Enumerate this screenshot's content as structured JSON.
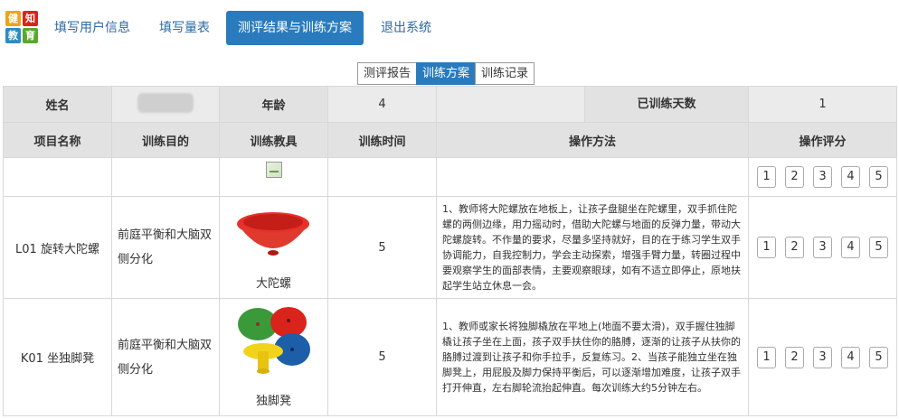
{
  "logo": {
    "chars": [
      "健",
      "知",
      "教",
      "育"
    ]
  },
  "nav": {
    "items": [
      {
        "label": "填写用户信息"
      },
      {
        "label": "填写量表"
      },
      {
        "label": "测评结果与训练方案"
      },
      {
        "label": "退出系统"
      }
    ],
    "active_index": 2
  },
  "subtabs": {
    "items": [
      {
        "label": "测评报告"
      },
      {
        "label": "训练方案"
      },
      {
        "label": "训练记录"
      }
    ],
    "active_index": 1
  },
  "info": {
    "name_label": "姓名",
    "name_value": "",
    "age_label": "年龄",
    "age_value": "4",
    "days_label": "已训练天数",
    "days_value": "1"
  },
  "headers": [
    "项目名称",
    "训练目的",
    "训练教具",
    "训练时间",
    "操作方法",
    "操作评分"
  ],
  "rating_labels": [
    "1",
    "2",
    "3",
    "4",
    "5"
  ],
  "rows": [
    {
      "name": "L01 旋转大陀螺",
      "purpose": "前庭平衡和大脑双侧分化",
      "tool": "大陀螺",
      "time": "5",
      "method": "1、教师将大陀螺放在地板上，让孩子盘腿坐在陀螺里，双手抓住陀螺的两侧边缘，用力摇动时，借助大陀螺与地面的反弹力量，带动大陀螺旋转。不作量的要求，尽量多坚持就好，目的在于练习学生双手协调能力，自我控制力，学会主动探索，增强手臂力量，转圈过程中要观察学生的面部表情，主要观察眼球，如有不适立即停止，原地扶起学生站立休息一会。"
    },
    {
      "name": "K01 坐独脚凳",
      "purpose": "前庭平衡和大脑双侧分化",
      "tool": "独脚凳",
      "time": "5",
      "method": "1、教师或家长将独脚橇放在平地上(地面不要太滑)，双手握住独脚橇让孩子坐在上面，孩子双手扶住你的胳膊，逐渐的让孩子从扶你的胳膊过渡到让孩子和你手拉手，反复练习。2、当孩子能独立坐在独脚凳上，用屁股及脚力保持平衡后，可以逐渐增加难度，让孩子双手打开伸直，左右脚轮流抬起伸直。每次训练大约5分钟左右。"
    }
  ],
  "colors": {
    "accent": "#2a7bbd",
    "header_bg": "#e2e2e2",
    "top_red": "#e8302b",
    "stool_green": "#3a9a3a",
    "stool_blue": "#1c5fa8",
    "stool_yellow": "#f2d31b",
    "stool_red": "#d9241c"
  }
}
